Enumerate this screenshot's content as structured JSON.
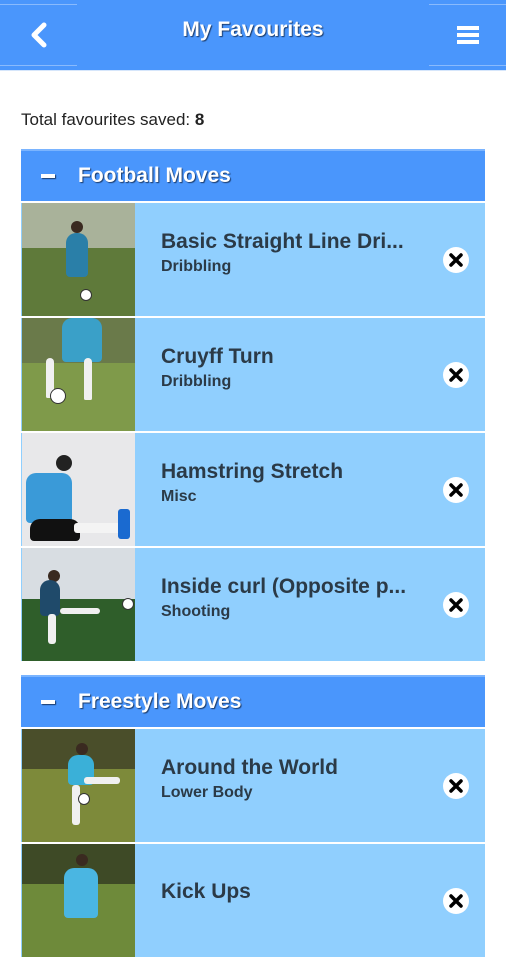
{
  "header": {
    "title": "My Favourites",
    "back_icon": "chevron-left-icon",
    "menu_icon": "hamburger-menu-icon"
  },
  "summary": {
    "label": "Total favourites saved: ",
    "count": "8"
  },
  "colors": {
    "primary": "#4a96fc",
    "item_bg": "#90cffe",
    "text_dark": "#2b3a47"
  },
  "sections": [
    {
      "title": "Football Moves",
      "items": [
        {
          "name": "Basic Straight Line Dri...",
          "category": "Dribbling"
        },
        {
          "name": "Cruyff Turn",
          "category": "Dribbling"
        },
        {
          "name": "Hamstring Stretch",
          "category": "Misc"
        },
        {
          "name": "Inside curl (Opposite p...",
          "category": "Shooting"
        }
      ]
    },
    {
      "title": "Freestyle Moves",
      "items": [
        {
          "name": "Around the World",
          "category": "Lower Body"
        },
        {
          "name": "Kick Ups",
          "category": ""
        }
      ]
    }
  ]
}
